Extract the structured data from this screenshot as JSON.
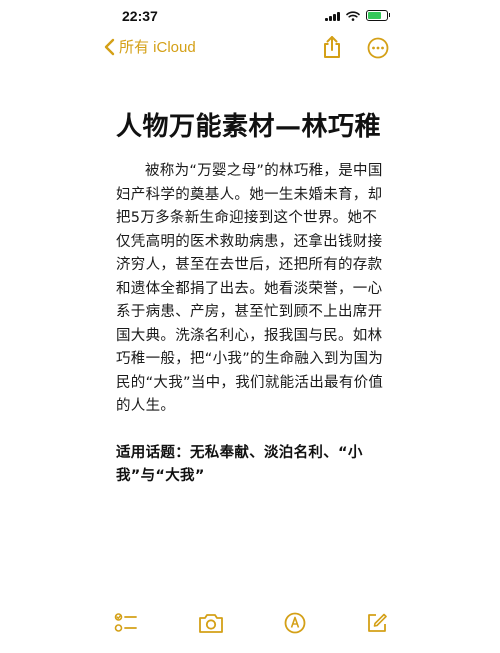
{
  "status_bar": {
    "time": "22:37",
    "battery_color": "#34c759"
  },
  "nav": {
    "back_label": "所有 iCloud",
    "accent_color": "#d4a017",
    "icons": [
      "chevron-left-icon",
      "share-icon",
      "more-icon"
    ]
  },
  "note": {
    "title": "人物万能素材—林巧稚",
    "body": "被称为“万婴之母”的林巧稚，是中国妇产科学的奠基人。她一生未婚未育，却把5万多条新生命迎接到这个世界。她不仅凭高明的医术救助病患，还拿出钱财接济穷人，甚至在去世后，还把所有的存款和遗体全都捐了出去。她看淡荣誉，一心系于病患、产房，甚至忙到顾不上出席开国大典。洗涤名利心，报我国与民。如林巧稚一般，把“小我”的生命融入到为国为民的“大我”当中，我们就能活出最有价值的人生。",
    "topic": "适用话题：无私奉献、淡泊名利、“小我”与“大我”"
  },
  "toolbar": {
    "icons": [
      "checklist-icon",
      "camera-icon",
      "markup-icon",
      "compose-icon"
    ]
  }
}
